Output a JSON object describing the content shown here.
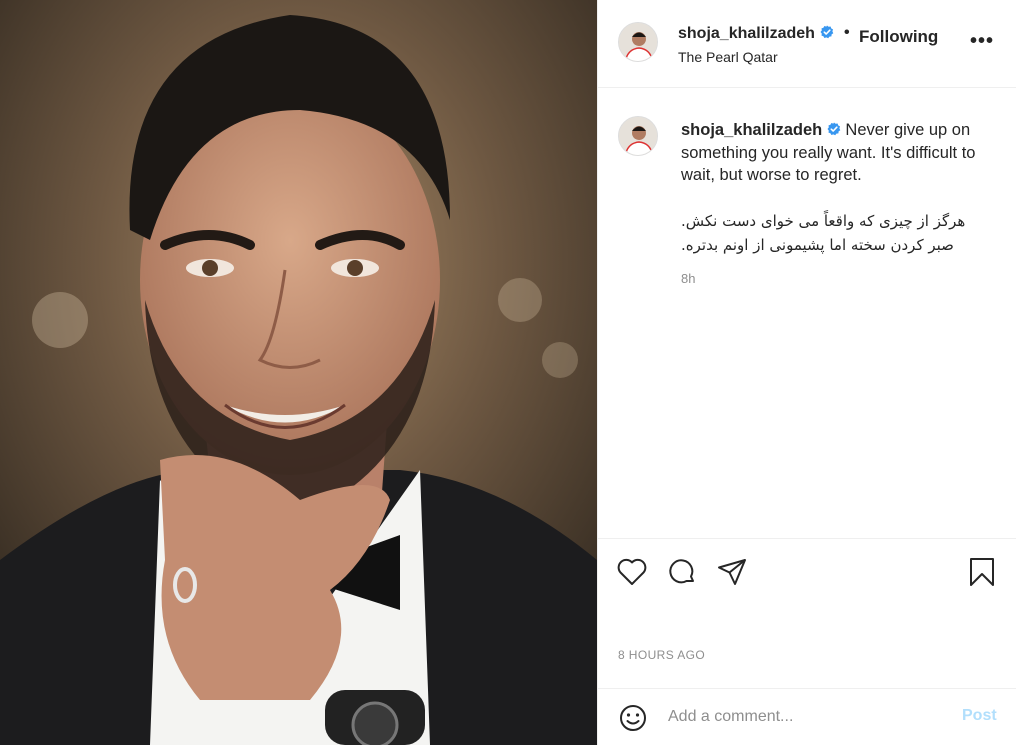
{
  "post": {
    "author": "shoja_khalilzadeh",
    "location": "The Pearl Qatar",
    "follow_separator": "•",
    "follow_state": "Following",
    "more_label": "•••",
    "caption_en": "Never give up on something you really want. It's difficult to wait, but worse to regret.",
    "caption_fa_line1": "هرگز از چیزی که واقعاً می خوای دست نکش.",
    "caption_fa_line2": "صبر کردن سخته اما پشیمونی از اونم بدتره.",
    "caption_age": "8h",
    "timestamp": "8 HOURS AGO"
  },
  "comment": {
    "placeholder": "Add a comment...",
    "post_label": "Post"
  },
  "icons": {
    "like": "heart-icon",
    "comment": "comment-icon",
    "share": "share-icon",
    "save": "bookmark-icon",
    "emoji": "emoji-icon",
    "verified": "verified-badge-icon"
  },
  "colors": {
    "text": "#262626",
    "muted": "#8e8e8e",
    "verified": "#3897f0",
    "post_disabled": "#b2dffc",
    "border": "#efefef"
  }
}
